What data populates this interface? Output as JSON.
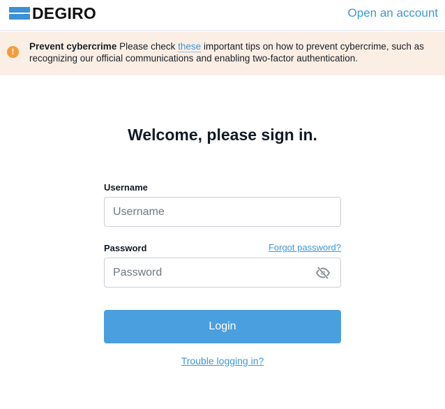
{
  "header": {
    "logo_text": "DEGIRO",
    "open_account_label": "Open an account"
  },
  "banner": {
    "icon": "warning-icon",
    "icon_glyph": "!",
    "title": "Prevent cybercrime",
    "text_before_link": "Please check",
    "link_text": "these",
    "text_after_link": "important tips on how to prevent cybercrime, such as recognizing our official communications and enabling two-factor authentication."
  },
  "login_form": {
    "heading": "Welcome, please sign in.",
    "username_label": "Username",
    "username_placeholder": "Username",
    "username_value": "",
    "password_label": "Password",
    "password_placeholder": "Password",
    "password_value": "",
    "forgot_password_label": "Forgot password?",
    "password_toggle_icon": "eye-slash-icon",
    "login_button_label": "Login",
    "trouble_link_label": "Trouble logging in?"
  },
  "colors": {
    "accent": "#3d97d8",
    "button": "#4a9fdf",
    "banner_background": "#fbeee4",
    "warning_icon": "#f39c3c"
  }
}
